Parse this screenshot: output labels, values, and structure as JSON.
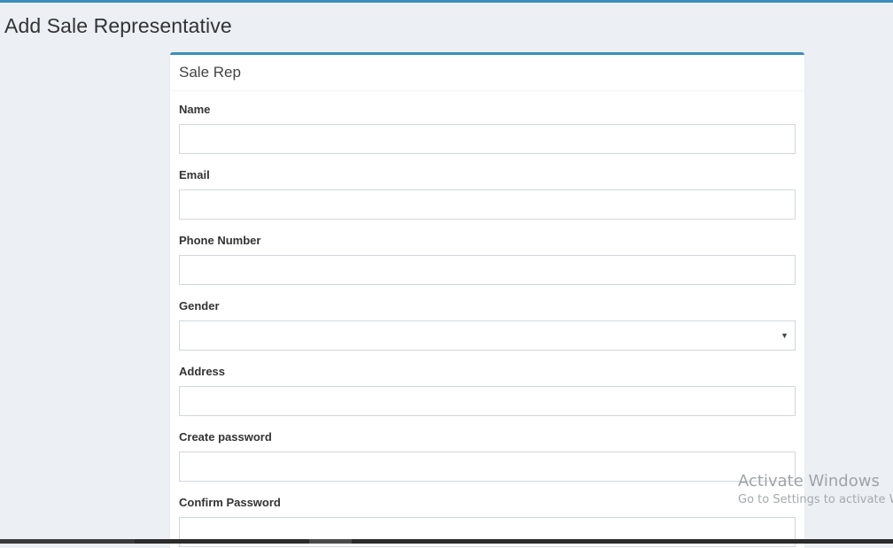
{
  "page": {
    "title": "Add Sale Representative"
  },
  "colors": {
    "accent": "#3c8dbc",
    "background": "#ecf0f5",
    "box_background": "#ffffff",
    "input_border": "#d2d6de"
  },
  "box": {
    "title": "Sale Rep"
  },
  "form": {
    "fields": [
      {
        "label": "Name",
        "type": "text",
        "value": "",
        "placeholder": ""
      },
      {
        "label": "Email",
        "type": "email",
        "value": "",
        "placeholder": ""
      },
      {
        "label": "Phone Number",
        "type": "text",
        "value": "",
        "placeholder": ""
      },
      {
        "label": "Gender",
        "type": "select",
        "value": "",
        "icon": "caret-down-icon"
      },
      {
        "label": "Address",
        "type": "text",
        "value": "",
        "placeholder": ""
      },
      {
        "label": "Create password",
        "type": "password",
        "value": "",
        "placeholder": ""
      },
      {
        "label": "Confirm Password",
        "type": "password",
        "value": "",
        "placeholder": ""
      }
    ]
  },
  "watermark": {
    "title": "Activate Windows",
    "subtitle": "Go to Settings to activate Windows."
  }
}
